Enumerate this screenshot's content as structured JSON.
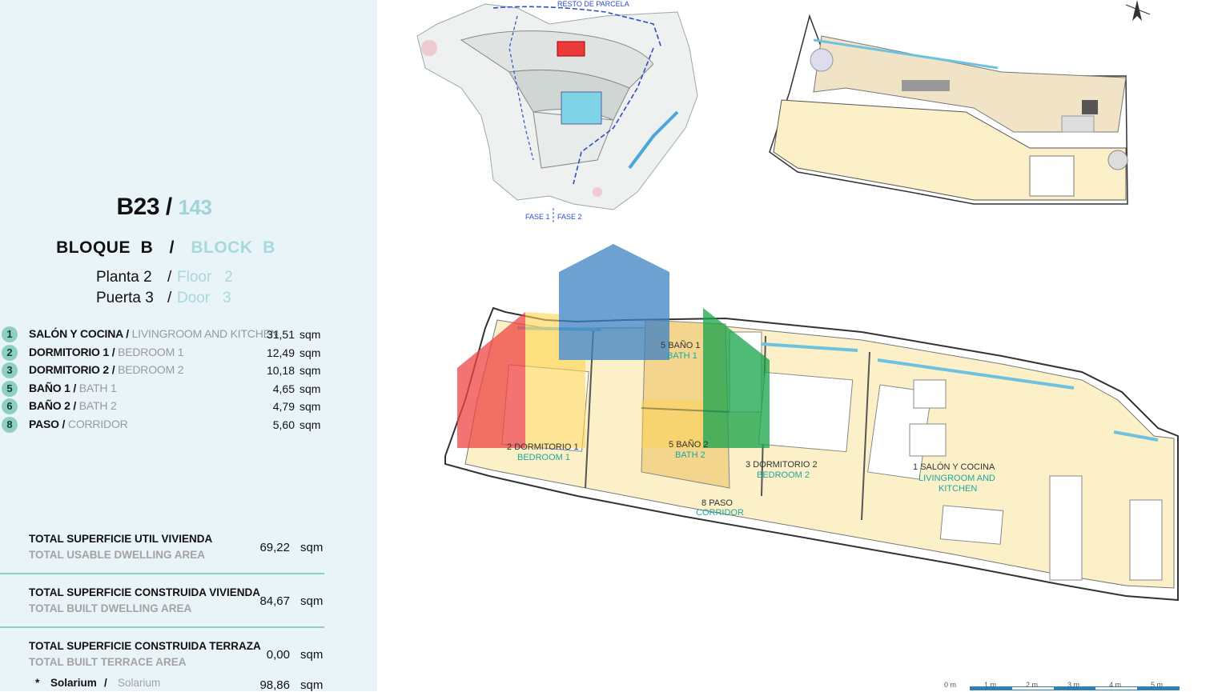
{
  "unit": {
    "code": "B23",
    "separator": "/",
    "number": "143"
  },
  "block": {
    "es": "BLOQUE  B",
    "separator": "/",
    "en": "BLOCK  B"
  },
  "floor": {
    "es": "Planta 2",
    "separator": "/",
    "en": "Floor   2"
  },
  "door": {
    "es": "Puerta 3",
    "separator": "/",
    "en": "Door   3"
  },
  "rooms": [
    {
      "num": "1",
      "es": "SALÓN Y COCINA",
      "sep": " / ",
      "en": "LIVINGROOM AND KITCHEN",
      "value": "31,51",
      "unit": "sqm"
    },
    {
      "num": "2",
      "es": "DORMITORIO 1",
      "sep": " / ",
      "en": "BEDROOM 1",
      "value": "12,49",
      "unit": "sqm"
    },
    {
      "num": "3",
      "es": "DORMITORIO 2",
      "sep": " / ",
      "en": "BEDROOM 2",
      "value": "10,18",
      "unit": "sqm"
    },
    {
      "num": "5",
      "es": "BAÑO 1",
      "sep": " / ",
      "en": "BATH 1",
      "value": "4,65",
      "unit": "sqm"
    },
    {
      "num": "6",
      "es": "BAÑO 2",
      "sep": " / ",
      "en": "BATH 2",
      "value": "4,79",
      "unit": "sqm"
    },
    {
      "num": "8",
      "es": "PASO",
      "sep": " / ",
      "en": "CORRIDOR",
      "value": "5,60",
      "unit": "sqm"
    }
  ],
  "totals": {
    "usable": {
      "es": "TOTAL SUPERFICIE UTIL VIVIENDA",
      "en": "TOTAL USABLE DWELLING AREA",
      "value": "69,22",
      "unit": "sqm"
    },
    "built": {
      "es": "TOTAL SUPERFICIE CONSTRUIDA VIVIENDA",
      "en": "TOTAL BUILT DWELLING AREA",
      "value": "84,67",
      "unit": "sqm"
    },
    "terrace": {
      "es": "TOTAL SUPERFICIE CONSTRUIDA TERRAZA",
      "en": "TOTAL BUILT TERRACE AREA",
      "value": "0,00",
      "unit": "sqm"
    },
    "solarium": {
      "star": "*",
      "es": "Solarium",
      "sep": "/",
      "en": "Solarium",
      "value": "98,86",
      "unit": "sqm"
    }
  },
  "site_plan": {
    "top_label": "RESTO DE PARCELA",
    "phase1": "FASE 1",
    "phase2": "FASE 2"
  },
  "plan_labels": {
    "bath1": {
      "num": "5",
      "es": "BAÑO 1",
      "en": "BATH 1"
    },
    "bath2": {
      "num": "5",
      "es": "BAÑO 2",
      "en": "BATH 2"
    },
    "bed1": {
      "num": "2",
      "es": "DORMITORIO 1",
      "en": "BEDROOM 1"
    },
    "bed2": {
      "num": "3",
      "es": "DORMITORIO 2",
      "en": "BEDROOM 2"
    },
    "living": {
      "num": "1",
      "es": "SALÓN Y COCINA",
      "en1": "LIVINGROOM AND",
      "en2": "KITCHEN"
    },
    "corridor": {
      "num": "8",
      "es": "PASO",
      "en": "CORRIDOR"
    }
  },
  "scale": [
    "0 m",
    "1 m",
    "2 m",
    "3 m",
    "4 m",
    "5 m"
  ],
  "colors": {
    "accent": "#8fcfc3",
    "alt_text": "#a8d8dc",
    "floor_fill": "#fbf0c7",
    "panel_bg": "#e8f4f8"
  }
}
